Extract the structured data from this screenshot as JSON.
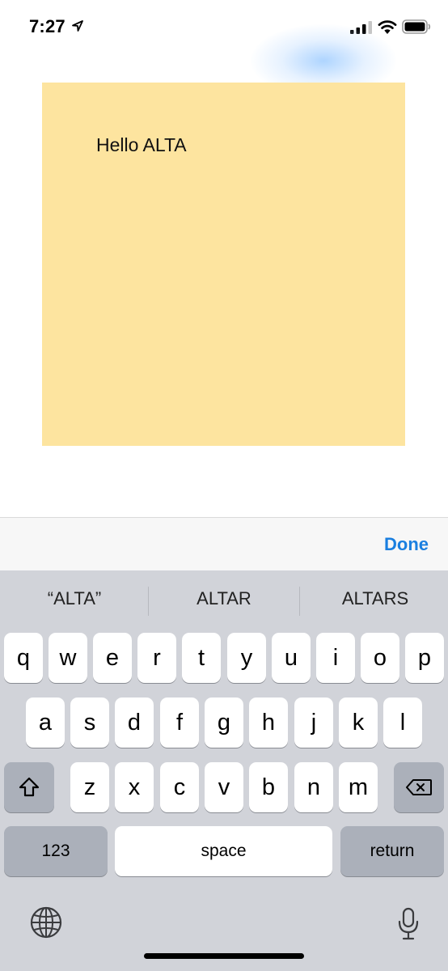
{
  "status_bar": {
    "time": "7:27"
  },
  "note": {
    "text": "Hello ALTA",
    "color": "#fde49f"
  },
  "accessory": {
    "done_label": "Done",
    "accent": "#1a7fe0"
  },
  "keyboard": {
    "suggestions": [
      "“ALTA”",
      "ALTAR",
      "ALTARS"
    ],
    "row1": [
      "q",
      "w",
      "e",
      "r",
      "t",
      "y",
      "u",
      "i",
      "o",
      "p"
    ],
    "row2": [
      "a",
      "s",
      "d",
      "f",
      "g",
      "h",
      "j",
      "k",
      "l"
    ],
    "row3": [
      "z",
      "x",
      "c",
      "v",
      "b",
      "n",
      "m"
    ],
    "numbers_label": "123",
    "space_label": "space",
    "return_label": "return",
    "icons": [
      "shift-icon",
      "backspace-icon",
      "globe-icon",
      "microphone-icon"
    ]
  }
}
